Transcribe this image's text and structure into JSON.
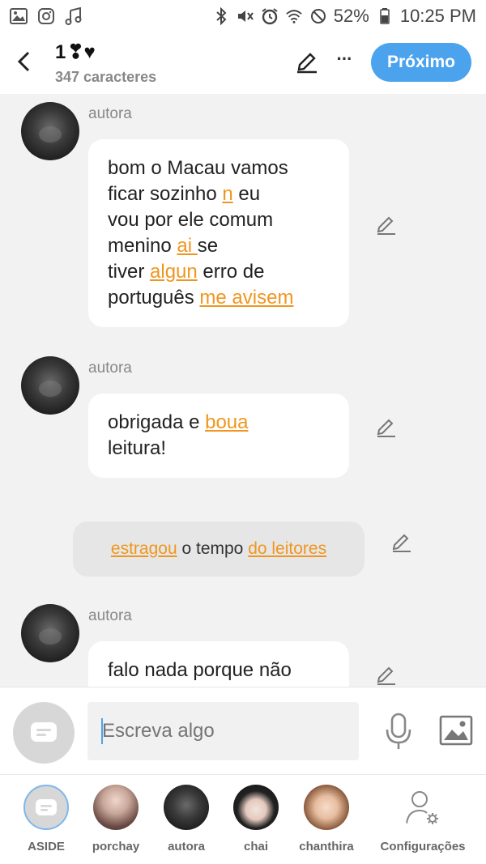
{
  "status_bar": {
    "battery": "52%",
    "time": "10:25 PM",
    "left_icons": [
      "gallery-icon",
      "instagram-icon",
      "music-icon"
    ],
    "right_icons": [
      "bluetooth-icon",
      "mute-icon",
      "alarm-icon",
      "wifi-icon",
      "do-not-disturb-icon",
      "battery-icon"
    ]
  },
  "header": {
    "title_text": "1",
    "title_emoji": "❣♥",
    "subtitle": "347 caracteres",
    "next_label": "Próximo",
    "more_label": "···"
  },
  "messages": [
    {
      "author": "autora",
      "lines": [
        [
          "bom o Macau vamos"
        ],
        [
          "ficar sozinho ",
          {
            "err": "n"
          },
          " eu"
        ],
        [
          "vou por ele comum"
        ],
        [
          "menino ",
          {
            "err": "ai "
          },
          " se"
        ],
        [
          "tiver ",
          {
            "err": "algun"
          },
          " erro de"
        ],
        [
          "português ",
          {
            "err": "me avisem"
          }
        ]
      ]
    },
    {
      "author": "autora",
      "lines": [
        [
          "obrigada e ",
          {
            "err": "boua"
          }
        ],
        [
          "leitura!"
        ]
      ]
    },
    {
      "author": "autora",
      "lines": [
        [
          "falo nada porque não"
        ]
      ]
    }
  ],
  "narration": {
    "parts": [
      {
        "err": "estragou"
      },
      " o tempo ",
      {
        "err": "do leitores"
      }
    ]
  },
  "composer": {
    "placeholder": "Escreva algo"
  },
  "bottom_nav": {
    "items": [
      {
        "label": "ASIDE"
      },
      {
        "label": "porchay"
      },
      {
        "label": "autora"
      },
      {
        "label": "chai"
      },
      {
        "label": "chanthira"
      },
      {
        "label": "Configurações"
      }
    ]
  },
  "colors": {
    "accent": "#4ba3ee",
    "error_highlight": "#f0961e",
    "background": "#f2f2f2"
  }
}
